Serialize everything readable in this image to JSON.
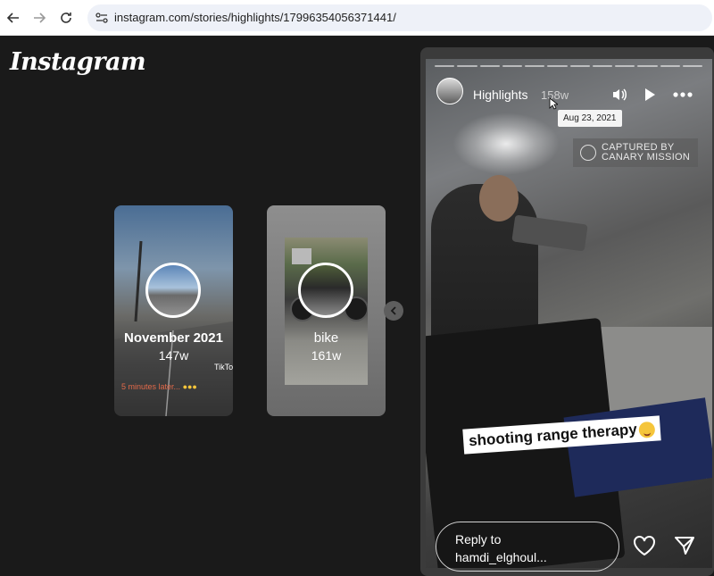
{
  "browser": {
    "url": "instagram.com/stories/highlights/17996354056371441/",
    "icons": [
      "back-arrow-icon",
      "forward-arrow-icon",
      "reload-icon",
      "site-settings-icon"
    ]
  },
  "app": {
    "logo": "Instagram"
  },
  "highlights": [
    {
      "title": "November 2021",
      "age": "147w",
      "caption": "5 minutes later...",
      "watermark": "TikTok"
    },
    {
      "title": "bike",
      "age": "161w"
    }
  ],
  "story": {
    "name": "Highlights",
    "age": "158w",
    "tooltip": "Aug 23, 2021",
    "progress_segments": 12,
    "watermark": "CAPTURED BY\nCANARY MISSION",
    "watermark_line1": "CAPTURED BY",
    "watermark_line2": "CANARY MISSION",
    "sticker": "shooting range therapy",
    "reply_placeholder": "Reply to hamdi_elghoul...",
    "reply_line1": "Reply to",
    "reply_line2": "hamdi_elghoul...",
    "icons": [
      "volume-icon",
      "play-icon",
      "more-icon",
      "heart-icon",
      "send-icon"
    ]
  },
  "colors": {
    "background": "#1a1a1a",
    "caption_red": "#e36a4a",
    "sticker_bg": "#ffffff"
  }
}
